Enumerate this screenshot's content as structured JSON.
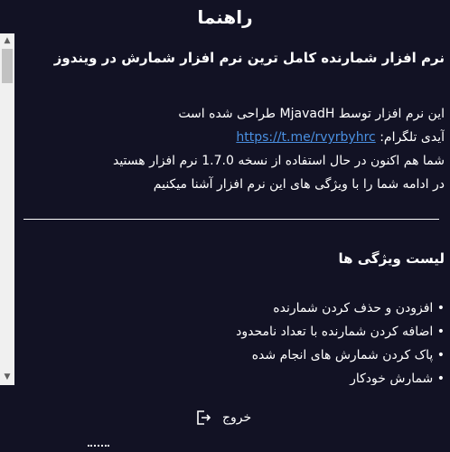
{
  "window": {
    "title": "راهنما"
  },
  "content": {
    "heading": "نرم افزار شمارنده کامل ترین نرم افزار شمارش در ویندوز",
    "intro_lines": [
      "این نرم افزار توسط MjavadH طراحی شده است",
      "شما هم اکنون در حال استفاده از نسخه 1.7.0 نرم افزار هستید",
      "در ادامه شما را با ویژگی های این نرم افزار آشنا میکنیم"
    ],
    "telegram_label": "آیدی تلگرام:",
    "telegram_link": "https://t.me/rvyrbyhrc",
    "features_title": "لیست ویژگی ها",
    "features": [
      "افزودن و حذف کردن شمارنده",
      "اضافه کردن شمارنده با تعداد نامحدود",
      "پاک کردن شمارش های انجام شده",
      "شمارش خودکار"
    ]
  },
  "footer": {
    "exit_label": "خروج"
  },
  "icons": {
    "exit": "exit-icon",
    "scroll_up": "chevron-up-icon",
    "scroll_down": "chevron-down-icon"
  },
  "colors": {
    "background": "#121224",
    "text": "#ffffff",
    "link": "#4a90e2"
  }
}
